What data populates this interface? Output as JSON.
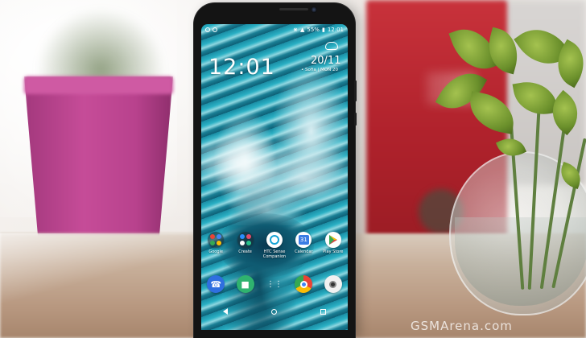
{
  "status_bar": {
    "battery": "55%",
    "time": "12:01"
  },
  "lockscreen": {
    "clock": "12:01",
    "date": "20/11",
    "location": "• Sofia | MON 20"
  },
  "apps": [
    {
      "label": "Google",
      "icon": "google-folder-icon"
    },
    {
      "label": "Create",
      "icon": "create-folder-icon"
    },
    {
      "label": "HTC Sense Companion",
      "icon": "htc-sense-companion-icon"
    },
    {
      "label": "Calendar",
      "icon": "calendar-icon",
      "day": "31"
    },
    {
      "label": "Play Store",
      "icon": "play-store-icon"
    }
  ],
  "dock": [
    {
      "icon": "phone-icon"
    },
    {
      "icon": "messages-icon"
    },
    {
      "icon": "app-drawer-icon"
    },
    {
      "icon": "chrome-icon"
    },
    {
      "icon": "camera-icon"
    }
  ],
  "watermark": "GSMArena.com",
  "colors": {
    "pot": "#c64c98",
    "red_box": "#b0222c",
    "screen_teal": "#1a8ea6",
    "leaf_green": "#6a8f2b"
  }
}
